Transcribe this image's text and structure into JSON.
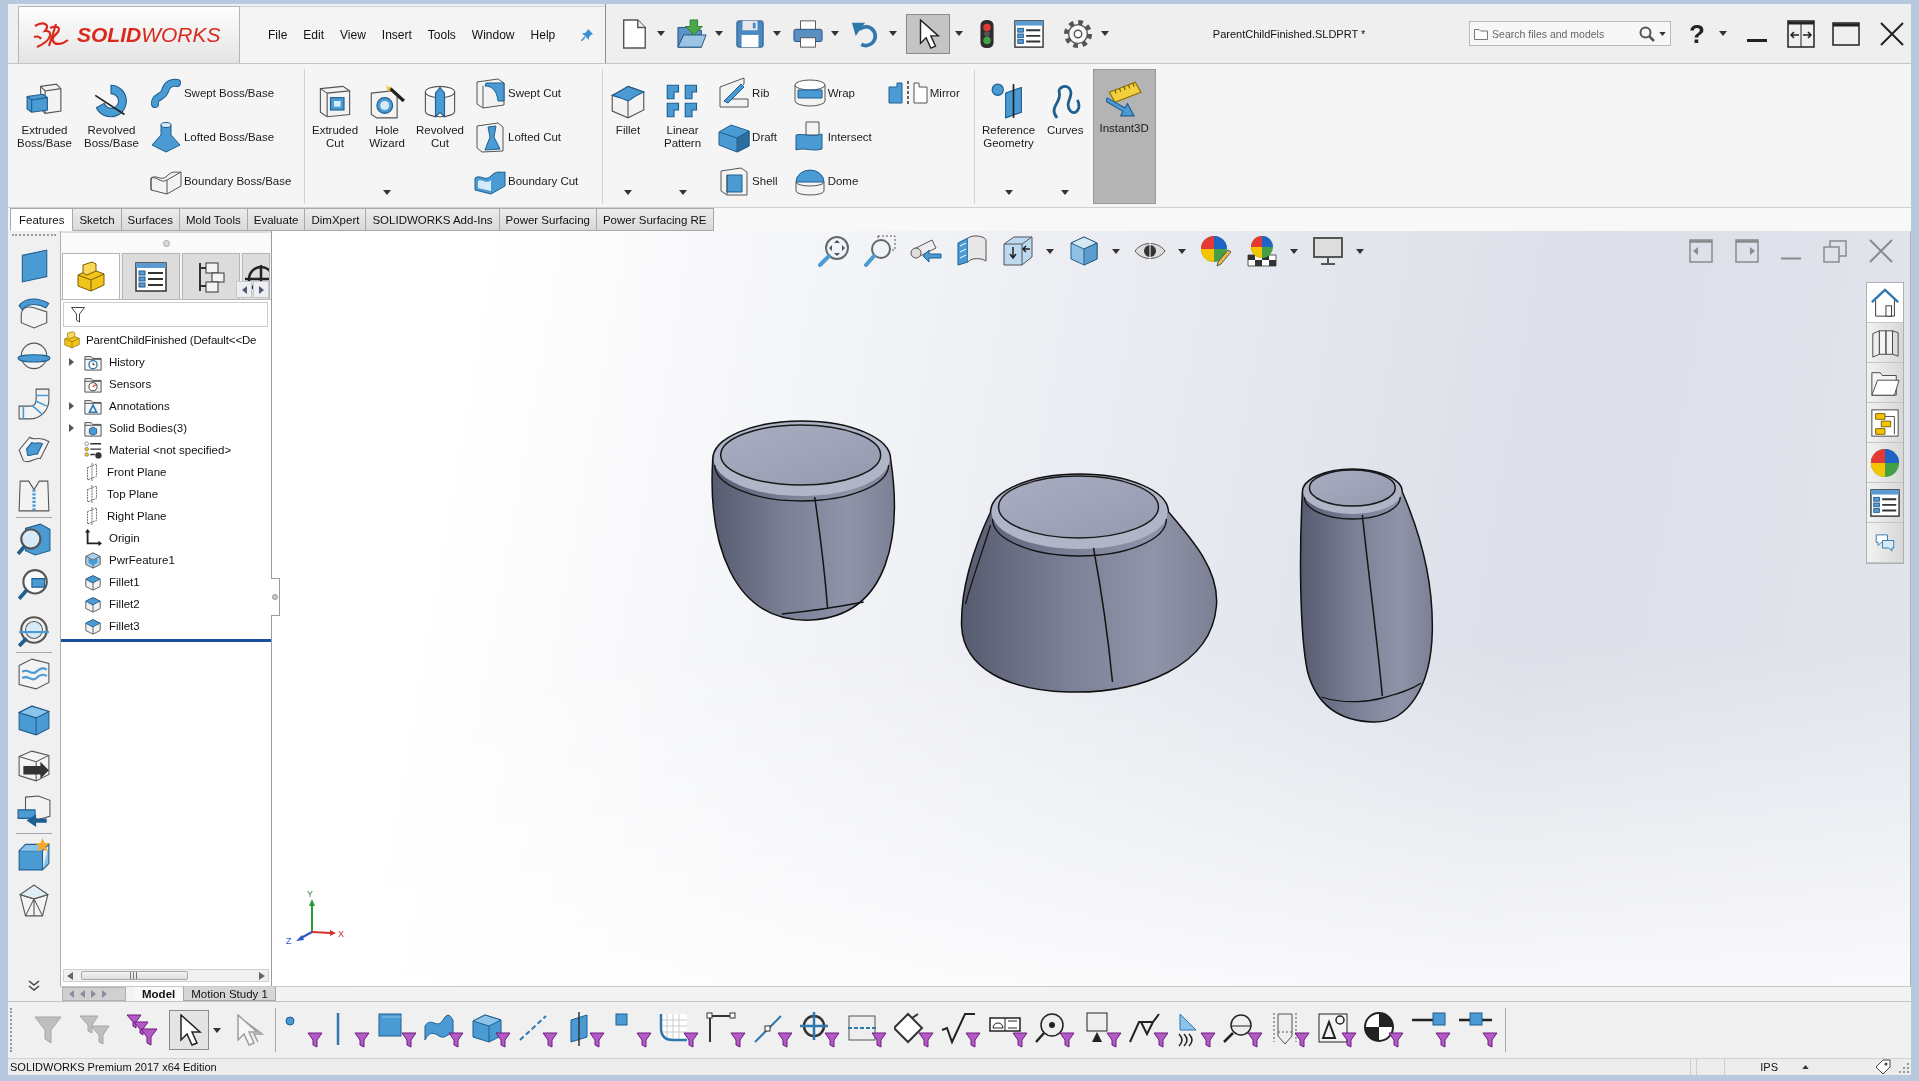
{
  "window": {
    "title": "ParentChildFinished.SLDPRT *"
  },
  "title_bar": {
    "logo": "**SOLID**WORKS",
    "menu": [
      "File",
      "Edit",
      "View",
      "Insert",
      "Tools",
      "Window",
      "Help"
    ],
    "help": "?"
  },
  "quick_access": {
    "tools": [
      {
        "has_menu": true,
        "selected": false
      },
      {
        "has_menu": true,
        "selected": false
      },
      {
        "has_menu": true,
        "selected": false
      },
      {
        "has_menu": true,
        "selected": false
      },
      {
        "has_menu": true,
        "selected": false
      },
      {
        "has_menu": true,
        "selected": true
      },
      {
        "has_menu": false,
        "selected": false
      },
      {
        "has_menu": false,
        "selected": false
      },
      {
        "has_menu": true,
        "selected": false
      }
    ]
  },
  "search": {
    "placeholder": "Search files and models"
  },
  "ribbon": {
    "groups": [
      {
        "columns": [
          {
            "kind": "large",
            "label": "Extruded Boss/Base",
            "has_menu": false,
            "pressed": false
          },
          {
            "kind": "large",
            "label": "Revolved Boss/Base",
            "has_menu": false,
            "pressed": false
          },
          {
            "kind": "stack",
            "items": [
              "Swept Boss/Base",
              "Lofted Boss/Base",
              "Boundary Boss/Base"
            ]
          }
        ]
      },
      {
        "columns": [
          {
            "kind": "large",
            "label": "Extruded Cut",
            "has_menu": false,
            "pressed": false
          },
          {
            "kind": "large",
            "label": "Hole Wizard",
            "has_menu": true,
            "pressed": false
          },
          {
            "kind": "large",
            "label": "Revolved Cut",
            "has_menu": false,
            "pressed": false
          },
          {
            "kind": "stack",
            "items": [
              "Swept Cut",
              "Lofted Cut",
              "Boundary Cut"
            ]
          }
        ]
      },
      {
        "columns": [
          {
            "kind": "large",
            "label": "Fillet",
            "has_menu": true,
            "pressed": false
          },
          {
            "kind": "large",
            "label": "Linear Pattern",
            "has_menu": true,
            "pressed": false
          },
          {
            "kind": "stack",
            "items": [
              "Rib",
              "Draft",
              "Shell"
            ]
          },
          {
            "kind": "stack",
            "items": [
              "Wrap",
              "Intersect",
              "Dome"
            ]
          },
          {
            "kind": "stack",
            "items": [
              "Mirror"
            ]
          }
        ]
      },
      {
        "columns": [
          {
            "kind": "large",
            "label": "Reference Geometry",
            "has_menu": true,
            "pressed": false
          },
          {
            "kind": "large",
            "label": "Curves",
            "has_menu": true,
            "pressed": false
          },
          {
            "kind": "large",
            "label": "Instant3D",
            "has_menu": false,
            "pressed": true
          }
        ]
      }
    ]
  },
  "command_tabs": [
    {
      "label": "Features",
      "selected": true
    },
    {
      "label": "Sketch",
      "selected": false
    },
    {
      "label": "Surfaces",
      "selected": false
    },
    {
      "label": "Mold Tools",
      "selected": false
    },
    {
      "label": "Evaluate",
      "selected": false
    },
    {
      "label": "DimXpert",
      "selected": false
    },
    {
      "label": "SOLIDWORKS Add-Ins",
      "selected": false
    },
    {
      "label": "Power Surfacing",
      "selected": false
    },
    {
      "label": "Power Surfacing RE",
      "selected": false
    }
  ],
  "feature_manager": {
    "tabs": [
      {
        "selected": true
      },
      {
        "selected": false
      },
      {
        "selected": false
      },
      {
        "selected": false
      }
    ],
    "tree": {
      "root": "ParentChildFinished (Default<<De",
      "items": [
        {
          "label": "History",
          "expandable": true,
          "expanded": false
        },
        {
          "label": "Sensors",
          "expandable": false
        },
        {
          "label": "Annotations",
          "expandable": true,
          "expanded": false
        },
        {
          "label": "Solid Bodies(3)",
          "expandable": true,
          "expanded": false
        },
        {
          "label": "Material <not specified>",
          "expandable": false
        },
        {
          "label": "Front Plane",
          "expandable": false
        },
        {
          "label": "Top Plane",
          "expandable": false
        },
        {
          "label": "Right Plane",
          "expandable": false
        },
        {
          "label": "Origin",
          "expandable": false
        },
        {
          "label": "PwrFeature1",
          "expandable": false
        },
        {
          "label": "Fillet1",
          "expandable": false
        },
        {
          "label": "Fillet2",
          "expandable": false
        },
        {
          "label": "Fillet3",
          "expandable": false
        }
      ]
    }
  },
  "view_toolbar": {
    "tools": [
      {
        "has_menu": false
      },
      {
        "has_menu": false
      },
      {
        "has_menu": false
      },
      {
        "has_menu": false
      },
      {
        "has_menu": true
      },
      {
        "has_menu": true
      },
      {
        "has_menu": true
      },
      {
        "has_menu": false
      },
      {
        "has_menu": true
      },
      {
        "has_menu": true
      }
    ]
  },
  "task_pane": {
    "tabs": [
      {
        "selected": true
      },
      {
        "selected": false
      },
      {
        "selected": false
      },
      {
        "selected": false
      },
      {
        "selected": false
      },
      {
        "selected": false
      },
      {
        "selected": false
      }
    ]
  },
  "triad": {
    "axes": [
      "Y",
      "X",
      "Z"
    ]
  },
  "bottom_tabs": [
    {
      "label": "Model",
      "selected": true
    },
    {
      "label": "Motion Study 1",
      "selected": false
    }
  ],
  "selection_toolbar": {
    "tools": [
      {
        "disabled": true,
        "selected": false,
        "has_menu": false
      },
      {
        "disabled": true,
        "selected": false,
        "has_menu": false
      },
      {
        "disabled": false,
        "selected": false,
        "has_menu": false
      },
      {
        "disabled": false,
        "selected": true,
        "has_menu": true
      },
      {
        "disabled": true,
        "selected": false,
        "has_menu": false
      }
    ]
  },
  "status_bar": {
    "edition": "SOLIDWORKS Premium 2017 x64 Edition",
    "units": "IPS"
  }
}
